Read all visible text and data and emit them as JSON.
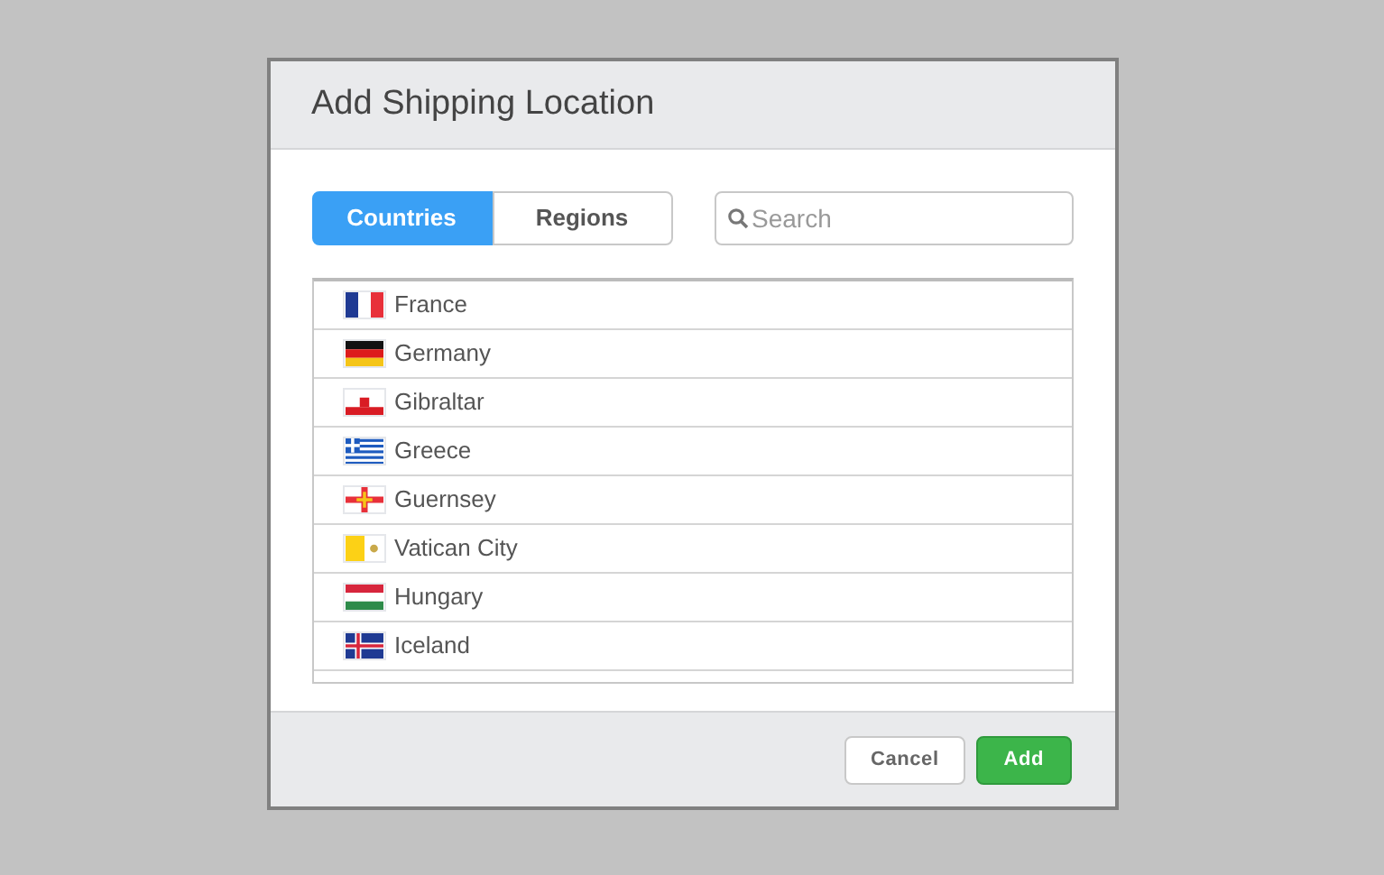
{
  "dialog": {
    "title": "Add Shipping Location"
  },
  "tabs": [
    {
      "label": "Countries",
      "selected": true
    },
    {
      "label": "Regions",
      "selected": false
    }
  ],
  "search": {
    "placeholder": "Search"
  },
  "countries": [
    {
      "name": "France",
      "kind": "france"
    },
    {
      "name": "Germany",
      "kind": "germany"
    },
    {
      "name": "Gibraltar",
      "kind": "gibraltar"
    },
    {
      "name": "Greece",
      "kind": "greece"
    },
    {
      "name": "Guernsey",
      "kind": "guernsey"
    },
    {
      "name": "Vatican City",
      "kind": "vatican"
    },
    {
      "name": "Hungary",
      "kind": "hungary"
    },
    {
      "name": "Iceland",
      "kind": "iceland"
    }
  ],
  "buttons": [
    {
      "label": "Cancel",
      "kind": "secondary"
    },
    {
      "label": "Add",
      "kind": "primary"
    }
  ]
}
